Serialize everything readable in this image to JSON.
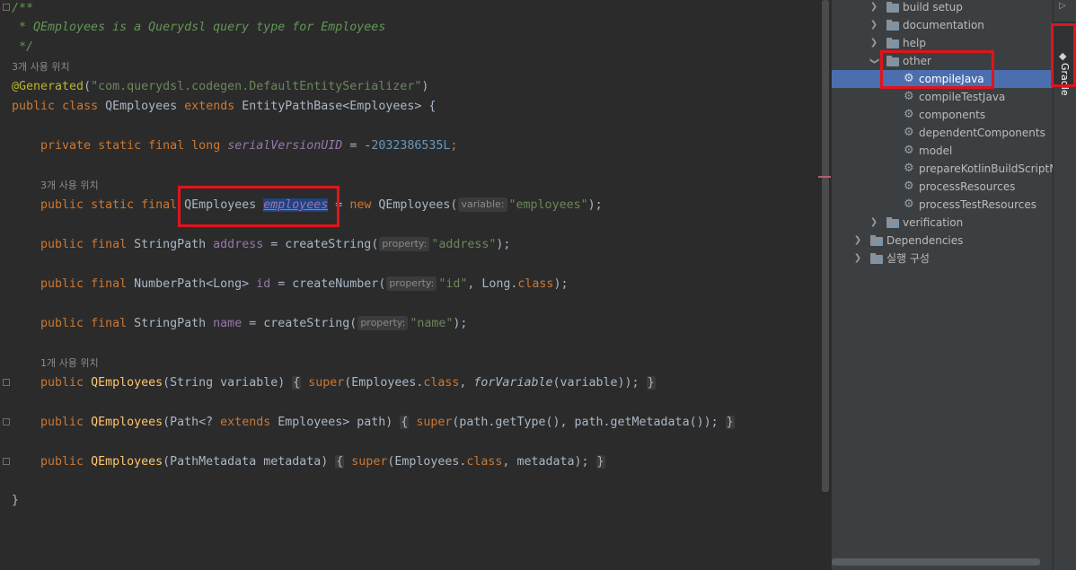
{
  "editor": {
    "lines": {
      "c1": "/**",
      "c2": " * QEmployees is a Querydsl query type for Employees",
      "c3": " */",
      "usage3": "3개 사용 위치",
      "annot": "@Generated",
      "annot_open": "(",
      "annot_str": "\"com.querydsl.codegen.DefaultEntitySerializer\"",
      "annot_close": ")",
      "kw_public": "public",
      "kw_class": "class",
      "kw_static": "static",
      "kw_final": "final",
      "kw_private": "private",
      "kw_long": "long",
      "kw_extends": "extends",
      "kw_new": "new",
      "kw_super": "super",
      "class_name": " QEmployees ",
      "class_tail": " EntityPathBase<Employees> {",
      "serial_field": "serialVersionUID",
      "serial_eq": " = -",
      "serial_num": "2032386535L",
      "semicolon": ";",
      "usage3b": "3개 사용 위치",
      "qemp_type": " QEmployees ",
      "qemp_field": "employees",
      "qemp_eq": " = ",
      "qemp_call": " QEmployees(",
      "hint_variable": "variable:",
      "str_employees": "\"employees\"",
      "close_paren_semi": ");",
      "stringpath": " StringPath ",
      "address": "address",
      "eq": " = ",
      "createString": "createString(",
      "hint_property": "property:",
      "str_address": "\"address\"",
      "numberpath": " NumberPath<Long> ",
      "id": "id",
      "createNumber": "createNumber(",
      "str_id": "\"id\"",
      "comma_long": ", Long.",
      "class_kw": "class",
      "name": "name",
      "str_name": "\"name\"",
      "usage1": "1개 사용 위치",
      "ctor": "QEmployees",
      "ctor1_args": "(String variable) ",
      "brace_open": "{",
      "brace_close": "}",
      "employees_class": "(Employees.",
      "comma_sp": ", ",
      "forVariable": "forVariable",
      "forVariable_args": "(variable));",
      "ctor2_args_a": "(Path<? ",
      "ctor2_args_b": " Employees> path) ",
      "ctor2_body": "(path.getType(), path.getMetadata());",
      "ctor3_args": "(PathMetadata metadata) ",
      "ctor3_tail": "metadata);",
      "final_brace": "}",
      "space": " "
    }
  },
  "tree": {
    "items": [
      {
        "label": "build setup",
        "kind": "folder"
      },
      {
        "label": "documentation",
        "kind": "folder"
      },
      {
        "label": "help",
        "kind": "folder"
      },
      {
        "label": "other",
        "kind": "folder",
        "expanded": true
      },
      {
        "label": "compileJava",
        "kind": "task",
        "selected": true
      },
      {
        "label": "compileTestJava",
        "kind": "task"
      },
      {
        "label": "components",
        "kind": "task"
      },
      {
        "label": "dependentComponents",
        "kind": "task"
      },
      {
        "label": "model",
        "kind": "task"
      },
      {
        "label": "prepareKotlinBuildScriptModel",
        "kind": "task"
      },
      {
        "label": "processResources",
        "kind": "task"
      },
      {
        "label": "processTestResources",
        "kind": "task"
      },
      {
        "label": "verification",
        "kind": "folder"
      },
      {
        "label": "Dependencies",
        "kind": "deps"
      },
      {
        "label": "실행 구성",
        "kind": "run"
      }
    ]
  },
  "sidebar": {
    "gradle_label": "Gradle"
  },
  "colors": {
    "highlight_box": "#e0141c",
    "selection": "#4b6eaf"
  }
}
